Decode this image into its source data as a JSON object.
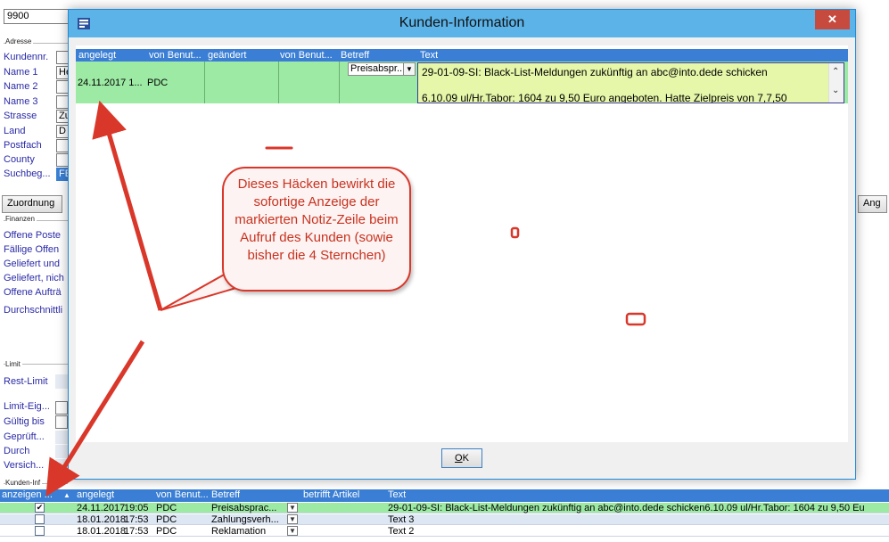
{
  "background": {
    "top_value": "9900",
    "address_group": "Adresse",
    "address_labels": [
      "Kundennr.",
      "Name 1",
      "Name 2",
      "Name 3",
      "Strasse",
      "Land",
      "Postfach",
      "County",
      "Suchbeg..."
    ],
    "address_values": [
      "",
      "He",
      "",
      "",
      "Zu",
      "D",
      "",
      "",
      "FE"
    ],
    "zuordnung_button": "Zuordnung",
    "ang_button": "Ang",
    "finance_group": "Finanzen",
    "finance_items": [
      "Offene Poste",
      "Fällige Offen",
      "Geliefert und",
      "Geliefert, nich",
      "Offene Aufträ"
    ],
    "durchschnitt_label": "Durchschnittli",
    "limit_group": "Limit",
    "rest_limit_label": "Rest-Limit",
    "limit_labels": [
      "Limit-Eig...",
      "Gültig bis",
      "Geprüft...",
      "Durch",
      "Versich..."
    ],
    "kunden_info_group": "Kunden-Inf"
  },
  "bottom_grid": {
    "headers": [
      "anzeigen ...",
      "angelegt",
      "von Benut...",
      "Betreff",
      "betrifft Artikel",
      "Text"
    ],
    "rows": [
      {
        "checked": true,
        "date": "24.11.2017",
        "time": "19:05",
        "user": "PDC",
        "subject": "Preisabsprac...",
        "text": "29-01-09-SI: Black-List-Meldungen zukünftig an abc@into.dede schicken6.10.09 ul/Hr.Tabor: 1604 zu 9,50 Eu"
      },
      {
        "checked": false,
        "date": "18.01.2018",
        "time": "17:53",
        "user": "PDC",
        "subject": "Zahlungsverh...",
        "text": "Text 3"
      },
      {
        "checked": false,
        "date": "18.01.2018",
        "time": "17:53",
        "user": "PDC",
        "subject": "Reklamation",
        "text": "Text 2"
      }
    ]
  },
  "dialog": {
    "title": "Kunden-Information",
    "close": "✕",
    "headers": [
      "angelegt",
      "von Benut...",
      "geändert",
      "von Benut...",
      "Betreff",
      "Text"
    ],
    "row": {
      "created": "24.11.2017 1...",
      "user": "PDC",
      "subject": "Preisabspr...",
      "text_line1": "29-01-09-SI: Black-List-Meldungen zukünftig an abc@into.dede schicken",
      "text_line2": "6.10.09 ul/Hr.Tabor: 1604 zu 9,50 Euro angeboten. Hatte Zielpreis von 7,7,50"
    },
    "ok_prefix": "O",
    "ok_suffix": "K"
  },
  "annotation": {
    "callout_text": "Dieses Häcken bewirkt die sofortige Anzeige der markierten Notiz-Zeile beim Aufruf des Kunden (sowie bisher die 4 Sternchen)",
    "color": "#d9372a"
  }
}
